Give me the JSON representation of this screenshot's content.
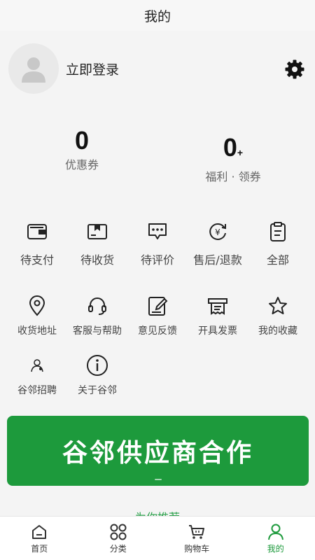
{
  "header": {
    "title": "我的"
  },
  "profile": {
    "login_label": "立即登录",
    "avatar_icon": "user-avatar-icon",
    "settings_icon": "gear-icon"
  },
  "stats": [
    {
      "value": "0",
      "suffix": "",
      "label": "优惠券"
    },
    {
      "value": "0",
      "suffix": "+",
      "label": "福利 · 领券"
    }
  ],
  "orders": [
    {
      "label": "待支付",
      "icon": "wallet-icon"
    },
    {
      "label": "待收货",
      "icon": "package-icon"
    },
    {
      "label": "待评价",
      "icon": "comment-icon"
    },
    {
      "label": "售后/退款",
      "icon": "refund-icon"
    },
    {
      "label": "全部",
      "icon": "clipboard-icon"
    }
  ],
  "services": [
    {
      "label": "收货地址",
      "icon": "location-icon"
    },
    {
      "label": "客服与帮助",
      "icon": "headset-icon"
    },
    {
      "label": "意见反馈",
      "icon": "feedback-icon"
    },
    {
      "label": "开具发票",
      "icon": "invoice-icon"
    },
    {
      "label": "我的收藏",
      "icon": "star-icon"
    }
  ],
  "more": [
    {
      "label": "谷邻招聘",
      "icon": "recruit-icon"
    },
    {
      "label": "关于谷邻",
      "icon": "info-icon"
    }
  ],
  "banner": {
    "text": "谷邻供应商合作"
  },
  "recommend": {
    "label": "为你推荐"
  },
  "tabbar": [
    {
      "label": "首页",
      "icon": "home-icon"
    },
    {
      "label": "分类",
      "icon": "category-icon"
    },
    {
      "label": "购物车",
      "icon": "cart-icon"
    },
    {
      "label": "我的",
      "icon": "user-icon"
    }
  ],
  "colors": {
    "accent": "#1d9a3c",
    "background": "#f4f4f4"
  }
}
